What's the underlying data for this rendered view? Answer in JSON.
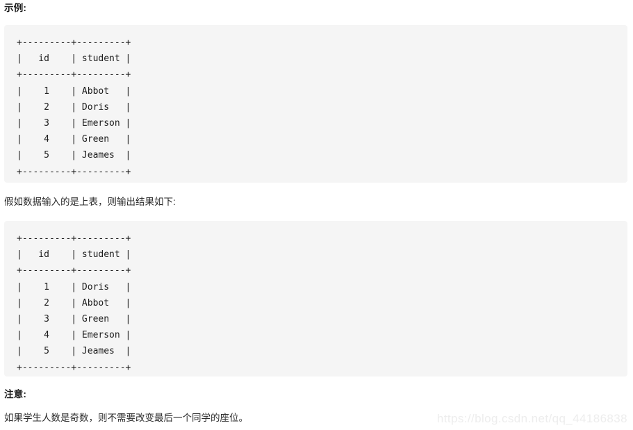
{
  "document": {
    "headings": {
      "example": "示例:",
      "note": "注意:"
    },
    "paragraphs": {
      "middle": "假如数据输入的是上表，则输出结果如下:",
      "note": "如果学生人数是奇数，则不需要改变最后一个同学的座位。"
    },
    "code_blocks": [
      {
        "id": "input-table",
        "language": "text",
        "background": "#f5f5f5",
        "columns": [
          "id",
          "student"
        ],
        "rows": [
          {
            "id": "1",
            "student": "Abbot"
          },
          {
            "id": "2",
            "student": "Doris"
          },
          {
            "id": "3",
            "student": "Emerson"
          },
          {
            "id": "4",
            "student": "Green"
          },
          {
            "id": "5",
            "student": "Jeames"
          }
        ],
        "text": "+---------+---------+\n|   id    | student |\n+---------+---------+\n|    1    | Abbot   |\n|    2    | Doris   |\n|    3    | Emerson |\n|    4    | Green   |\n|    5    | Jeames  |\n+---------+---------+"
      },
      {
        "id": "output-table",
        "language": "text",
        "background": "#f5f5f5",
        "columns": [
          "id",
          "student"
        ],
        "rows": [
          {
            "id": "1",
            "student": "Doris"
          },
          {
            "id": "2",
            "student": "Abbot"
          },
          {
            "id": "3",
            "student": "Green"
          },
          {
            "id": "4",
            "student": "Emerson"
          },
          {
            "id": "5",
            "student": "Jeames"
          }
        ],
        "text": "+---------+---------+\n|   id    | student |\n+---------+---------+\n|    1    | Doris   |\n|    2    | Abbot   |\n|    3    | Green   |\n|    4    | Emerson |\n|    5    | Jeames  |\n+---------+---------+"
      }
    ],
    "watermark": "https://blog.csdn.net/qq_44186838"
  }
}
